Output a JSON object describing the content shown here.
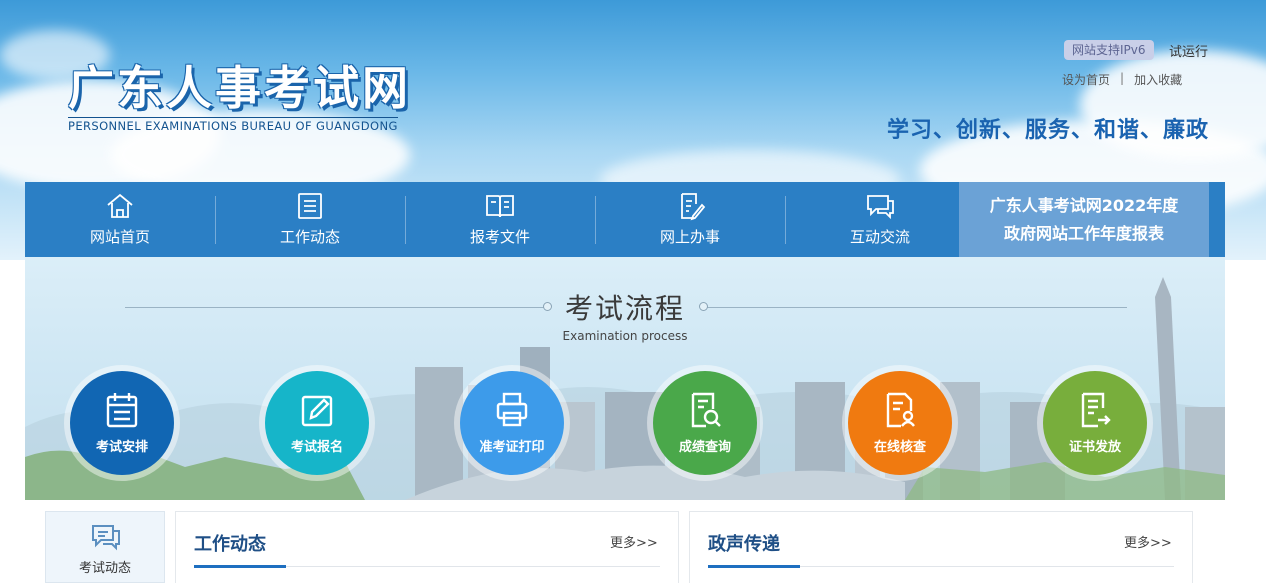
{
  "header": {
    "title": "广东人事考试网",
    "subtitle": "PERSONNEL EXAMINATIONS BUREAU OF GUANGDONG",
    "ipv6_badge": "网站支持IPv6",
    "trial": "试运行",
    "set_home": "设为首页",
    "separator": "|",
    "add_favorite": "加入收藏",
    "slogan": "学习、创新、服务、和谐、廉政"
  },
  "nav": {
    "items": [
      {
        "label": "网站首页",
        "icon": "home-icon"
      },
      {
        "label": "工作动态",
        "icon": "list-icon"
      },
      {
        "label": "报考文件",
        "icon": "book-icon"
      },
      {
        "label": "网上办事",
        "icon": "edit-doc-icon"
      },
      {
        "label": "互动交流",
        "icon": "chat-icon"
      }
    ],
    "report_line1": "广东人事考试网2022年度",
    "report_line2": "政府网站工作年度报表"
  },
  "process": {
    "title": "考试流程",
    "subtitle": "Examination process",
    "steps": [
      {
        "label": "考试安排",
        "color": "#1166b3",
        "icon": "calendar-icon"
      },
      {
        "label": "考试报名",
        "color": "#16b5c9",
        "icon": "pencil-icon"
      },
      {
        "label": "准考证打印",
        "color": "#3d9bea",
        "icon": "printer-icon"
      },
      {
        "label": "成绩查询",
        "color": "#4aa84a",
        "icon": "search-doc-icon"
      },
      {
        "label": "在线核查",
        "color": "#f07a10",
        "icon": "verify-doc-icon"
      },
      {
        "label": "证书发放",
        "color": "#78ae3c",
        "icon": "certificate-icon"
      }
    ]
  },
  "sidebar": {
    "label": "考试动态",
    "icon": "chat-bubble-icon"
  },
  "panels": [
    {
      "title": "工作动态",
      "more": "更多>>"
    },
    {
      "title": "政声传递",
      "more": "更多>>"
    }
  ],
  "colors": {
    "nav": "#2b7fc5",
    "report": "#6ba2d6",
    "title": "#1f4f86",
    "accent": "#1e6fc0"
  }
}
